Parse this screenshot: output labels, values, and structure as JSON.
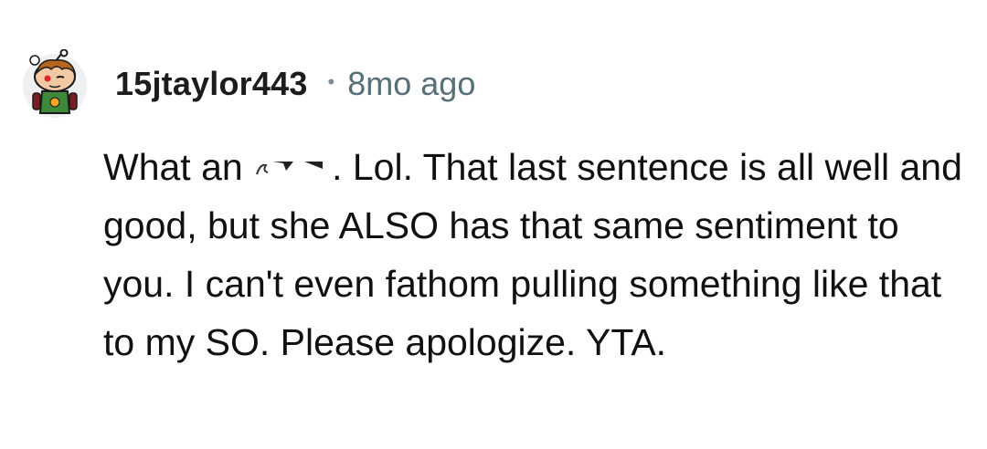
{
  "comment": {
    "author": "15jtaylor443",
    "separator": "•",
    "timestamp": "8mo ago",
    "avatar": "reddit-snoo-avatar",
    "body": {
      "prefix": "What an ",
      "censored_word_icon": "censored-word",
      "suffix": ". Lol. That last sentence is all well and good, but she ALSO has that same sentiment to you. I can't even fathom pulling something like that to my SO. Please apologize. YTA."
    }
  }
}
